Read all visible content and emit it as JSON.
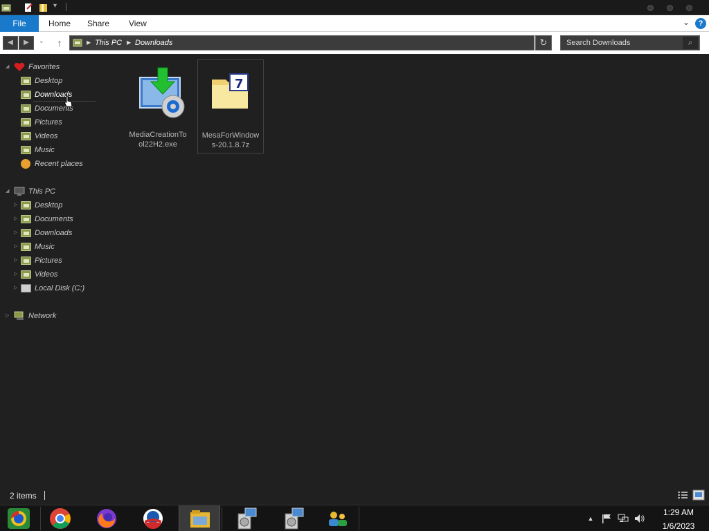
{
  "ribbon": {
    "tabs": [
      {
        "label": "File"
      },
      {
        "label": "Home"
      },
      {
        "label": "Share"
      },
      {
        "label": "View"
      }
    ],
    "help_label": "?"
  },
  "address": {
    "segments": [
      "This PC",
      "Downloads"
    ],
    "search_placeholder": "Search Downloads"
  },
  "nav": {
    "favorites": {
      "label": "Favorites",
      "items": [
        {
          "label": "Desktop"
        },
        {
          "label": "Downloads"
        },
        {
          "label": "Documents"
        },
        {
          "label": "Pictures"
        },
        {
          "label": "Videos"
        },
        {
          "label": "Music"
        },
        {
          "label": "Recent places"
        }
      ]
    },
    "this_pc": {
      "label": "This PC",
      "items": [
        {
          "label": "Desktop"
        },
        {
          "label": "Documents"
        },
        {
          "label": "Downloads"
        },
        {
          "label": "Music"
        },
        {
          "label": "Pictures"
        },
        {
          "label": "Videos"
        },
        {
          "label": "Local Disk (C:)"
        }
      ]
    },
    "network": {
      "label": "Network"
    }
  },
  "files": [
    {
      "name": "MediaCreationTool22H2.exe",
      "line1": "MediaCreationTo",
      "line2": "ol22H2.exe",
      "icon": "media-creation-tool-icon"
    },
    {
      "name": "MesaForWindows-20.1.8.7z",
      "line1": "MesaForWindow",
      "line2": "s-20.1.8.7z",
      "icon": "7zip-archive-icon"
    }
  ],
  "status": {
    "item_count": "2 items"
  },
  "taskbar": {
    "apps": [
      "chrome-icon",
      "firefox-icon",
      "obama-logo-icon",
      "file-explorer-icon",
      "installer-icon",
      "installer-icon",
      "network-users-icon"
    ],
    "clock_time": "1:29 AM",
    "clock_date": "1/6/2023"
  },
  "colors": {
    "accent": "#1979ca",
    "background": "#202020",
    "folder": "#8a9a4a"
  }
}
